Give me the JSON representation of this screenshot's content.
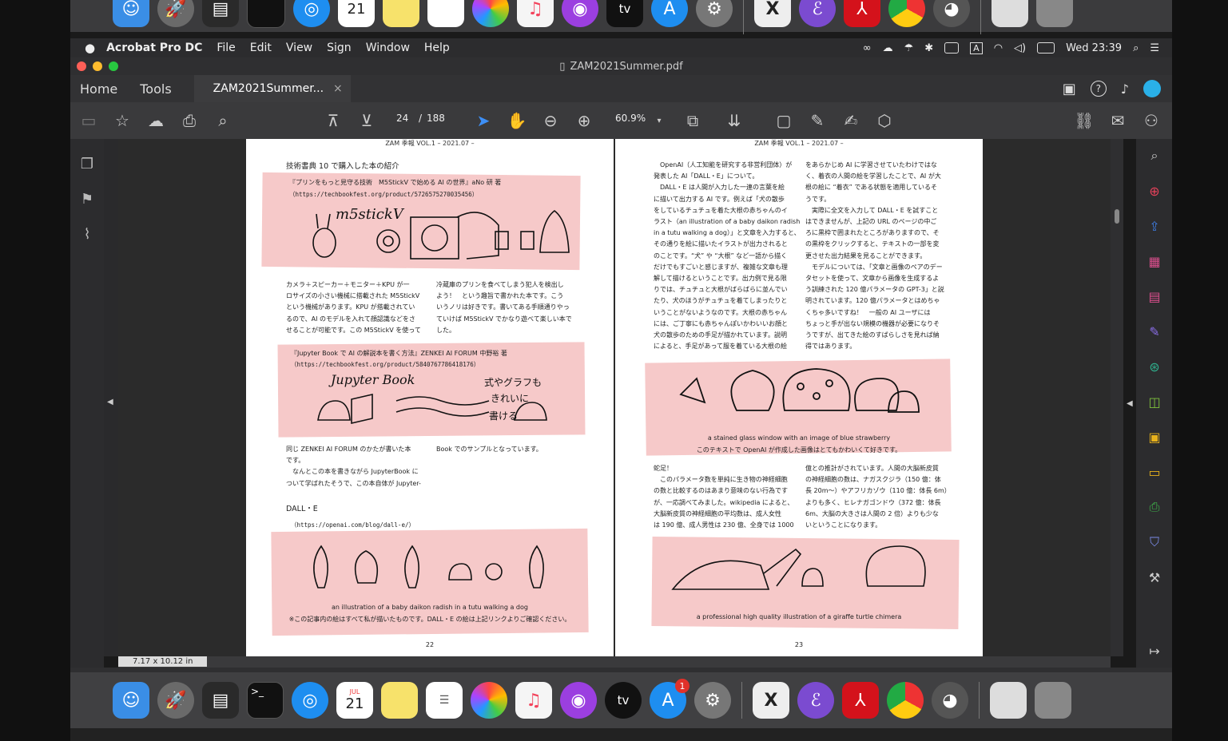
{
  "menubar": {
    "app_name": "Acrobat Pro DC",
    "items": [
      "File",
      "Edit",
      "View",
      "Sign",
      "Window",
      "Help"
    ],
    "clock": "Wed 23:39",
    "input_indicator": "A"
  },
  "window": {
    "title": "ZAM2021Summer.pdf"
  },
  "tabs": {
    "home": "Home",
    "tools": "Tools",
    "doc": "ZAM2021Summer...",
    "close": "×"
  },
  "toolbar": {
    "page_current": "24",
    "page_sep": "/",
    "page_total": "188",
    "zoom": "60.9%"
  },
  "status": {
    "page_size": "7.17 x 10.12 in"
  },
  "dock": {
    "calendar_month": "JUL",
    "calendar_day": "21",
    "appstore_badge": "1",
    "tv_label": "tv"
  },
  "left_page": {
    "header": "ZAM 季報 VOL.1 – 2021.07 –",
    "section_title": "技術書典 10 で購入した本の紹介",
    "book1_title": "『プリンをもっと見守る技術　M5StickV で始める AI の世界』aNo 研 著",
    "book1_url": "（https://techbookfest.org/product/5726575270035456）",
    "book1_art": "m5stickV",
    "col1": [
      "カメラ＋スピーカー＋モニター＋KPU が一",
      "ロサイズの小さい機械に搭載された M5StickV",
      "という機械があります。KPU が搭載されてい",
      "るので、AI のモデルを入れて顔認識などをさ",
      "せることが可能です。この M5StickV を使って"
    ],
    "col2": [
      "冷蔵庫のプリンを食べてしまう犯人を検出し",
      "よう！　という趣旨で書かれた本です。こう",
      "いうノリは好きです。書いてある手順通りやっ",
      "ていけば M5StickV でかなり遊べて楽しい本で",
      "した。"
    ],
    "book2_title": "『Jupyter Book で AI の解説本を書く方法』ZENKEI AI FORUM 中野裕 著",
    "book2_url": "（https://techbookfest.org/product/5840767786418176）",
    "book2_art1": "Jupyter Book",
    "book2_art2": "式やグラフも",
    "book2_art3": "きれいに",
    "book2_art4": "書ける",
    "col3": [
      "同じ ZENKEI AI FORUM のかたが書いた本",
      "です。",
      "　なんとこの本を書きながら JupyterBook に",
      "ついて学ばれたそうで、この本自体が Jupyter-"
    ],
    "col4": [
      "Book でのサンプルとなっています。"
    ],
    "dalle_heading": "DALL・E",
    "dalle_url": "（https://openai.com/blog/dall-e/）",
    "caption1": "an illustration of a baby daikon radish in a tutu walking a dog",
    "caption2": "※この記事内の絵はすべて私が描いたものです。DALL・E の絵は上記リンクよりご確認ください。",
    "page_number": "22"
  },
  "right_page": {
    "header": "ZAM 季報 VOL.1 – 2021.07 –",
    "col1": [
      "　OpenAI（人工知能を研究する非営利団体）が",
      "発表した AI「DALL・E」について。",
      "　DALL・E は人間が入力した一連の言葉を絵",
      "に描いて出力する AI です。例えば「犬の散歩",
      "をしているチュチュを着た大根の赤ちゃんのイ",
      "ラスト（an illustration of a baby daikon radish",
      "in a tutu walking a dog）」と文章を入力すると、",
      "その通りを絵に描いたイラストが出力されると",
      "のことです。“犬” や “大根” など一語から描く",
      "だけでもすごいと感じますが、複雑な文章も理",
      "解して描けるということです。出力例で見る限",
      "りでは、チュチュと大根がばらばらに並んでい",
      "たり、犬のほうがチュチュを着てしまったりと",
      "いうことがないようなのです。大根の赤ちゃん",
      "には、ご丁寧にも赤ちゃんぽいかわいいお顔と",
      "犬の散歩のための手足が描かれています。説明",
      "によると、手足があって服を着ている大根の絵"
    ],
    "col2": [
      "をあらかじめ AI に学習させていたわけではな",
      "く、着衣の人間の絵を学習したことで、AI が大",
      "根の絵に “着衣” である状態を適用しているそ",
      "うです。",
      "　実際に全文を入力して DALL・E を試すこと",
      "はできませんが、上記の URL のページの中ご",
      "ろに黒枠で囲まれたところがありますので、そ",
      "の黒枠をクリックすると、テキストの一部を変",
      "更させた出力結果を見ることができます。",
      "　モデルについては、「文章と画像のペアのデー",
      "タセットを使って、文章から画像を生成するよ",
      "う訓練された 120 億パラメータの GPT-3」と説",
      "明されています。120 億パラメータとはめちゃ",
      "くちゃ多いですね！　一般の AI ユーザには",
      "ちょっと手が出ない規模の機器が必要になりそ",
      "うですが、出てきた絵のすばらしさを見れば納",
      "得ではあります。"
    ],
    "caption1": "a stained glass window with an image of blue strawberry",
    "caption2": "このテキストで OpenAI が作成した画像はとてもかわいくて好きです。",
    "col3": [
      "蛇足！",
      "　このパラメータ数を単純に生き物の神経細胞",
      "の数と比較するのはあまり意味のない行為です",
      "が、一応調べてみました。wikipedia によると、",
      "大脳新皮質の神経細胞の平均数は、成人女性",
      "は 190 億、成人男性は 230 億、全身では 1000"
    ],
    "col4": [
      "億との推計がされています。人間の大脳新皮質",
      "の神経細胞の数は、ナガスクジラ（150 億：体",
      "長 20m〜）やアフリカゾウ（110 億：体長 6m）",
      "よりも多く、ヒレナガゴンドウ（372 億：体長",
      "6m、大脳の大きさは人間の 2 倍）よりも少な",
      "いということになります。"
    ],
    "caption3": "a professional high quality illustration of a giraffe turtle chimera",
    "page_number": "23"
  }
}
